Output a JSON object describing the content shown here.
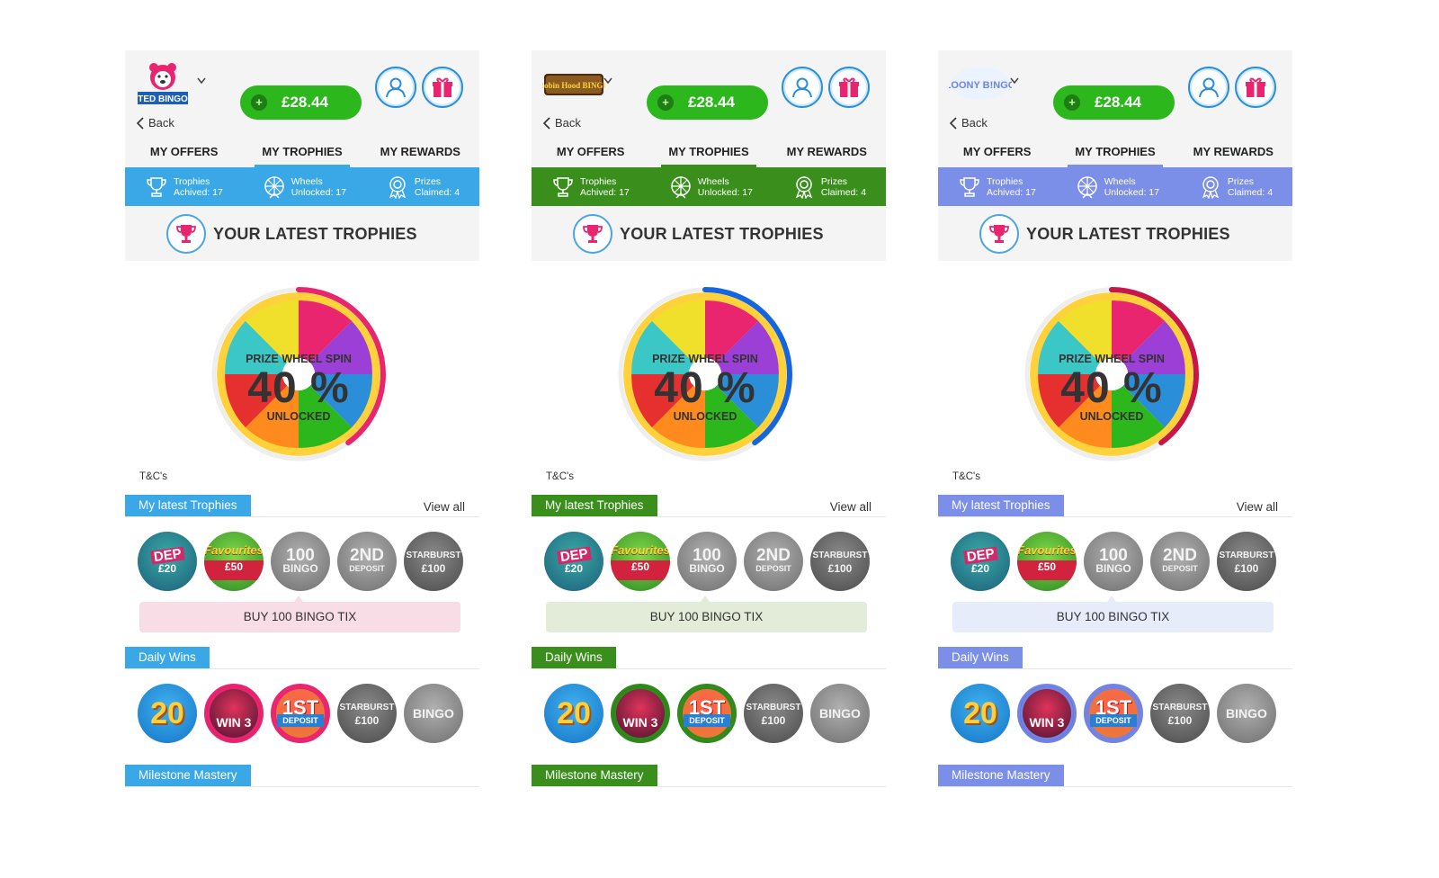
{
  "panels": [
    {
      "brand": "TED BINGO",
      "accent": "#3aa8e6",
      "ring_color": "#e8256e",
      "ring2": "#e8256e",
      "soft": "#f8dce6",
      "back_label": "Back",
      "balance": "£28.44",
      "balance_plus": "+",
      "tabs": [
        "MY OFFERS",
        "MY TROPHIES",
        "MY REWARDS"
      ],
      "stats": [
        {
          "line1": "Trophies",
          "line2": "Achived: 17"
        },
        {
          "line1": "Wheels",
          "line2": "Unlocked: 17"
        },
        {
          "line1": "Prizes",
          "line2": "Claimed: 4"
        }
      ],
      "latest_title": "YOUR LATEST TROPHIES",
      "progress": {
        "label_top": "PRIZE WHEEL SPIN",
        "percent_text": "40 %",
        "value": 0.4,
        "label_bottom": "UNLOCKED"
      },
      "tc": "T&C's",
      "sections": {
        "latest": "My latest Trophies",
        "daily": "Daily Wins",
        "milestone": "Milestone Mastery"
      },
      "view_all": "View all",
      "hint": "BUY 100 BINGO TIX",
      "trophies": [
        {
          "t1": "DEP",
          "t2": "£20"
        },
        {
          "t1": "Favourites",
          "t2": "£50"
        },
        {
          "t1": "100",
          "t2": "BINGO"
        },
        {
          "t1": "2ND",
          "t2": "DEPOSIT"
        },
        {
          "t1": "STARBURST",
          "t2": "£100"
        }
      ],
      "daily": [
        {
          "t1": "20",
          "t2": ""
        },
        {
          "t1": "WIN 3",
          "t2": ""
        },
        {
          "t1": "1ST",
          "t2": "DEPOSIT"
        },
        {
          "t1": "STARBURST",
          "t2": "£100"
        },
        {
          "t1": "BINGO",
          "t2": ""
        }
      ]
    },
    {
      "brand": "Robin Hood BINGO",
      "accent": "#3a8f1c",
      "ring_color": "#1565e0",
      "ring2": "#2e8a1b",
      "soft": "#e3ecd9",
      "back_label": "Back",
      "balance": "£28.44",
      "balance_plus": "+",
      "tabs": [
        "MY OFFERS",
        "MY TROPHIES",
        "MY REWARDS"
      ],
      "stats": [
        {
          "line1": "Trophies",
          "line2": "Achived: 17"
        },
        {
          "line1": "Wheels",
          "line2": "Unlocked: 17"
        },
        {
          "line1": "Prizes",
          "line2": "Claimed: 4"
        }
      ],
      "latest_title": "YOUR LATEST TROPHIES",
      "progress": {
        "label_top": "PRIZE WHEEL SPIN",
        "percent_text": "40 %",
        "value": 0.4,
        "label_bottom": "UNLOCKED"
      },
      "tc": "T&C's",
      "sections": {
        "latest": "My latest Trophies",
        "daily": "Daily Wins",
        "milestone": "Milestone Mastery"
      },
      "view_all": "View all",
      "hint": "BUY 100 BINGO TIX",
      "trophies": [
        {
          "t1": "DEP",
          "t2": "£20"
        },
        {
          "t1": "Favourites",
          "t2": "£50"
        },
        {
          "t1": "100",
          "t2": "BINGO"
        },
        {
          "t1": "2ND",
          "t2": "DEPOSIT"
        },
        {
          "t1": "STARBURST",
          "t2": "£100"
        }
      ],
      "daily": [
        {
          "t1": "20",
          "t2": ""
        },
        {
          "t1": "WIN 3",
          "t2": ""
        },
        {
          "t1": "1ST",
          "t2": "DEPOSIT"
        },
        {
          "t1": "STARBURST",
          "t2": "£100"
        },
        {
          "t1": "BINGO",
          "t2": ""
        }
      ]
    },
    {
      "brand": "LOONY B!NGO",
      "accent": "#7b8ee8",
      "ring_color": "#c8154a",
      "ring2": "#6f84e4",
      "soft": "#e6ecfa",
      "back_label": "Back",
      "balance": "£28.44",
      "balance_plus": "+",
      "tabs": [
        "MY OFFERS",
        "MY TROPHIES",
        "MY REWARDS"
      ],
      "stats": [
        {
          "line1": "Trophies",
          "line2": "Achived: 17"
        },
        {
          "line1": "Wheels",
          "line2": "Unlocked: 17"
        },
        {
          "line1": "Prizes",
          "line2": "Claimed: 4"
        }
      ],
      "latest_title": "YOUR LATEST TROPHIES",
      "progress": {
        "label_top": "PRIZE WHEEL SPIN",
        "percent_text": "40 %",
        "value": 0.4,
        "label_bottom": "UNLOCKED"
      },
      "tc": "T&C's",
      "sections": {
        "latest": "My latest Trophies",
        "daily": "Daily Wins",
        "milestone": "Milestone Mastery"
      },
      "view_all": "View all",
      "hint": "BUY 100 BINGO TIX",
      "trophies": [
        {
          "t1": "DEP",
          "t2": "£20"
        },
        {
          "t1": "Favourites",
          "t2": "£50"
        },
        {
          "t1": "100",
          "t2": "BINGO"
        },
        {
          "t1": "2ND",
          "t2": "DEPOSIT"
        },
        {
          "t1": "STARBURST",
          "t2": "£100"
        }
      ],
      "daily": [
        {
          "t1": "20",
          "t2": ""
        },
        {
          "t1": "WIN 3",
          "t2": ""
        },
        {
          "t1": "1ST",
          "t2": "DEPOSIT"
        },
        {
          "t1": "STARBURST",
          "t2": "£100"
        },
        {
          "t1": "BINGO",
          "t2": ""
        }
      ]
    }
  ]
}
